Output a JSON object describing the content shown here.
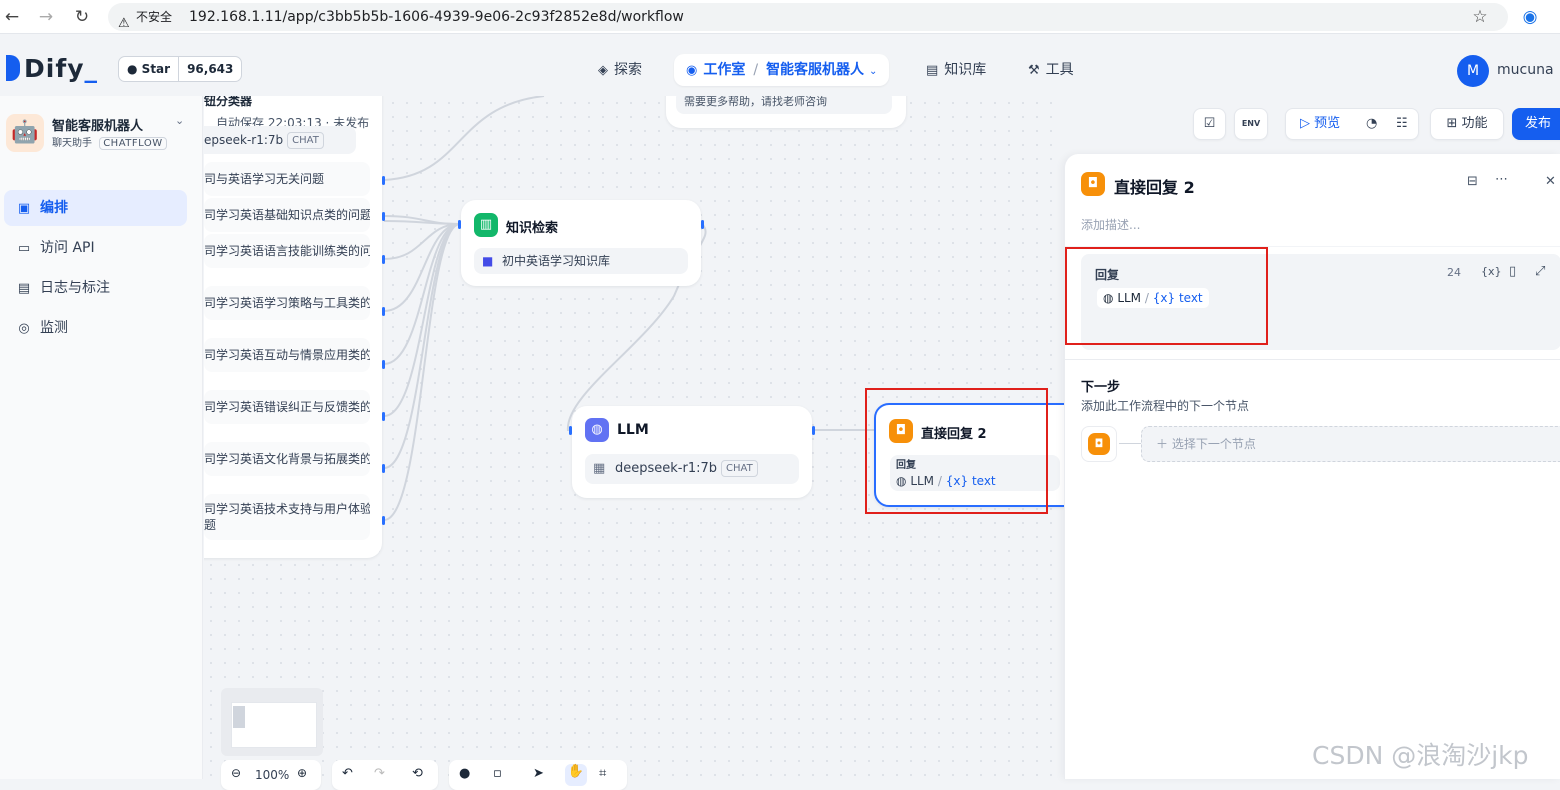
{
  "browser": {
    "security_label": "不安全",
    "url": "192.168.1.11/app/c3bb5b5b-1606-4939-9e06-2c93f2852e8d/workflow"
  },
  "header": {
    "logo": "Dify",
    "github_star_label": "Star",
    "github_star_count": "96,643",
    "nav": {
      "explore": "探索",
      "studio": "工作室",
      "current_app": "智能客服机器人",
      "knowledge": "知识库",
      "tools": "工具"
    },
    "user_initial": "M",
    "user_name": "mucuna"
  },
  "sidebar": {
    "app_name": "智能客服机器人",
    "app_type": "聊天助手",
    "app_mode": "CHATFLOW",
    "items": [
      {
        "label": "编排",
        "active": true
      },
      {
        "label": "访问 API",
        "active": false
      },
      {
        "label": "日志与标注",
        "active": false
      },
      {
        "label": "监测",
        "active": false
      }
    ]
  },
  "toolbar": {
    "autosave": "自动保存 22:03:13 · 未发布",
    "preview": "预览",
    "features": "功能",
    "publish": "发布",
    "env": "ENV"
  },
  "canvas": {
    "classifier_title_partial": "钮分类器",
    "classifier_model": "epseek-r1:7b",
    "classifier_model_chip": "CHAT",
    "classes": [
      "司与英语学习无关问题",
      "司学习英语基础知识点类的问题",
      "司学习英语语言技能训练类的问",
      "司学习英语学习策略与工具类的",
      "司学习英语互动与情景应用类的",
      "司学习英语错误纠正与反馈类的",
      "司学习英语文化背景与拓展类的",
      "司学习英语技术支持与用户体验"
    ],
    "class_last_tail": "题",
    "top_answer_text": "需要更多帮助，请找老师咨询",
    "knowledge_node": {
      "title": "知识检索",
      "dataset": "初中英语学习知识库"
    },
    "llm_node": {
      "title": "LLM",
      "model": "deepseek-r1:7b",
      "model_chip": "CHAT"
    },
    "reply_node": {
      "title": "直接回复 2",
      "field_label": "回复",
      "var_source": "LLM",
      "var_name": "text",
      "var_prefix": "{x}"
    }
  },
  "panel": {
    "title": "直接回复 2",
    "description_placeholder": "添加描述...",
    "reply_label": "回复",
    "reply_count": "24",
    "reply_var_source": "LLM",
    "reply_var_name": "text",
    "reply_var_prefix": "{x}",
    "next_step_title": "下一步",
    "next_step_desc": "添加此工作流程中的下一个节点",
    "select_next_node": "选择下一个节点",
    "var_icon_label": "{x}"
  },
  "zoom": "100%",
  "watermark": "CSDN @浪淘沙jkp"
}
